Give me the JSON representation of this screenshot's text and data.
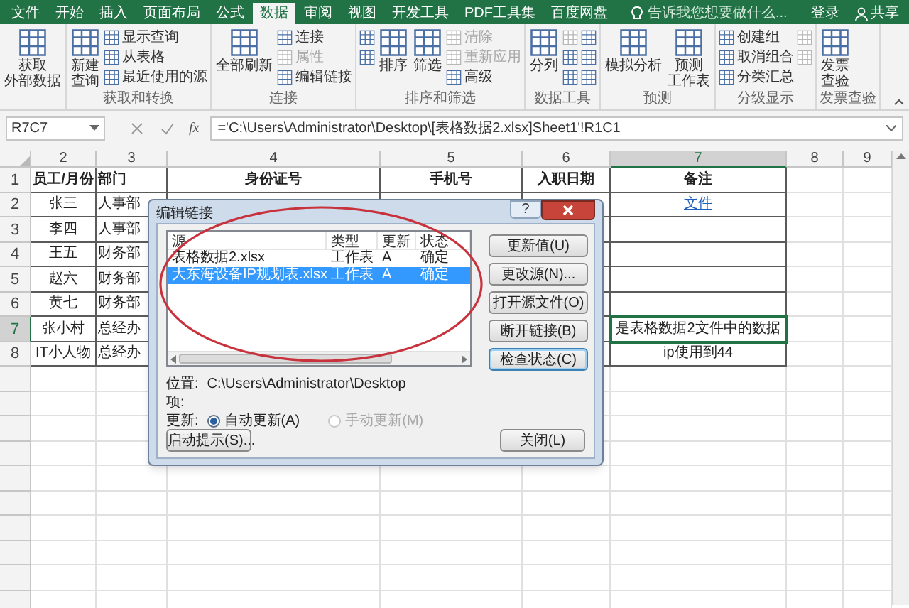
{
  "tabs": [
    {
      "label": "文件",
      "selected": false
    },
    {
      "label": "开始",
      "selected": false
    },
    {
      "label": "插入",
      "selected": false
    },
    {
      "label": "页面布局",
      "selected": false
    },
    {
      "label": "公式",
      "selected": false
    },
    {
      "label": "数据",
      "selected": true
    },
    {
      "label": "审阅",
      "selected": false
    },
    {
      "label": "视图",
      "selected": false
    },
    {
      "label": "开发工具",
      "selected": false
    },
    {
      "label": "PDF工具集",
      "selected": false
    },
    {
      "label": "百度网盘",
      "selected": false
    }
  ],
  "tell_me": {
    "placeholder": "告诉我您想要做什么..."
  },
  "account": {
    "sign_in": "登录",
    "share": "共享"
  },
  "ribbon": {
    "groups": [
      {
        "items": [
          {
            "kind": "large",
            "lines": [
              "获取",
              "外部数据"
            ],
            "disabled": false
          }
        ]
      },
      {
        "label": "获取和转换",
        "items": [
          {
            "kind": "large",
            "lines": [
              "新建",
              "查询"
            ],
            "disabled": false
          },
          {
            "kind": "small",
            "label": "显示查询",
            "disabled": false
          },
          {
            "kind": "small",
            "label": "从表格",
            "disabled": false
          },
          {
            "kind": "small",
            "label": "最近使用的源",
            "disabled": false
          }
        ]
      },
      {
        "label": "连接",
        "items": [
          {
            "kind": "large",
            "lines": [
              "全部刷新"
            ],
            "disabled": false
          },
          {
            "kind": "small",
            "label": "连接",
            "disabled": false
          },
          {
            "kind": "small",
            "label": "属性",
            "disabled": true
          },
          {
            "kind": "small",
            "label": "编辑链接",
            "disabled": false
          }
        ]
      },
      {
        "label": "排序和筛选",
        "items": [
          {
            "kind": "icon",
            "disabled": false
          },
          {
            "kind": "icon",
            "disabled": false
          },
          {
            "kind": "large",
            "lines": [
              "排序"
            ],
            "disabled": false
          },
          {
            "kind": "large",
            "lines": [
              "筛选"
            ],
            "disabled": false
          },
          {
            "kind": "small",
            "label": "清除",
            "disabled": true
          },
          {
            "kind": "small",
            "label": "重新应用",
            "disabled": true
          },
          {
            "kind": "small",
            "label": "高级",
            "disabled": false
          }
        ]
      },
      {
        "label": "数据工具",
        "items": [
          {
            "kind": "large",
            "lines": [
              "分列"
            ],
            "disabled": false
          },
          {
            "kind": "icon",
            "disabled": true
          },
          {
            "kind": "icon",
            "disabled": false
          },
          {
            "kind": "icon",
            "disabled": false
          },
          {
            "kind": "icon",
            "disabled": false
          },
          {
            "kind": "icon",
            "disabled": false
          },
          {
            "kind": "icon",
            "disabled": false
          }
        ]
      },
      {
        "label": "预测",
        "items": [
          {
            "kind": "large",
            "lines": [
              "模拟分析"
            ],
            "disabled": false
          },
          {
            "kind": "large",
            "lines": [
              "预测",
              "工作表"
            ],
            "disabled": false
          }
        ]
      },
      {
        "label": "分级显示",
        "items": [
          {
            "kind": "small",
            "label": "创建组",
            "disabled": false
          },
          {
            "kind": "small",
            "label": "取消组合",
            "disabled": false
          },
          {
            "kind": "small",
            "label": "分类汇总",
            "disabled": false
          },
          {
            "kind": "icon",
            "disabled": true
          },
          {
            "kind": "icon",
            "disabled": true
          }
        ]
      },
      {
        "label": "发票查验",
        "items": [
          {
            "kind": "large",
            "lines": [
              "发票",
              "查验"
            ],
            "disabled": false
          }
        ]
      }
    ]
  },
  "formula_bar": {
    "name_box": "R7C7",
    "function_label": "fx",
    "formula": "='C:\\Users\\Administrator\\Desktop\\[表格数据2.xlsx]Sheet1'!R1C1"
  },
  "sheet": {
    "columns": [
      {
        "label": "2",
        "selected": false
      },
      {
        "label": "3",
        "selected": false
      },
      {
        "label": "4",
        "selected": false
      },
      {
        "label": "5",
        "selected": false
      },
      {
        "label": "6",
        "selected": false
      },
      {
        "label": "7",
        "selected": true
      },
      {
        "label": "8",
        "selected": false
      },
      {
        "label": "9",
        "selected": false
      }
    ],
    "header_row": {
      "label": "1",
      "selected": false,
      "cells": [
        "员工/月份",
        "部门",
        "身份证号",
        "手机号",
        "入职日期",
        "备注"
      ]
    },
    "rows": [
      {
        "label": "2",
        "selected": false,
        "employee": "张三",
        "department": "人事部",
        "note": {
          "kind": "link",
          "text": "文件"
        }
      },
      {
        "label": "3",
        "selected": false,
        "employee": "李四",
        "department": "人事部"
      },
      {
        "label": "4",
        "selected": false,
        "employee": "王五",
        "department": "财务部"
      },
      {
        "label": "5",
        "selected": false,
        "employee": "赵六",
        "department": "财务部"
      },
      {
        "label": "6",
        "selected": false,
        "employee": "黄七",
        "department": "财务部"
      },
      {
        "label": "7",
        "selected": true,
        "employee": "张小村",
        "department": "总经办",
        "note": {
          "kind": "text",
          "text": "是表格数据2文件中的数据"
        }
      },
      {
        "label": "8",
        "selected": false,
        "employee": "IT小人物",
        "department": "总经办",
        "note": {
          "kind": "text",
          "text": "ip使用到44"
        }
      }
    ]
  },
  "dialog": {
    "title": "编辑链接",
    "help": "?",
    "columns": [
      "源",
      "类型",
      "更新",
      "状态"
    ],
    "links": [
      {
        "source": "表格数据2.xlsx",
        "type": "工作表",
        "update": "A",
        "status": "确定",
        "selected": false
      },
      {
        "source": "大东海设备IP规划表.xlsx",
        "type": "工作表",
        "update": "A",
        "status": "确定",
        "selected": true
      }
    ],
    "buttons": [
      {
        "label": "更新值(U)",
        "default": false
      },
      {
        "label": "更改源(N)...",
        "default": false
      },
      {
        "label": "打开源文件(O)",
        "default": false
      },
      {
        "label": "断开链接(B)",
        "default": false
      },
      {
        "label": "检查状态(C)",
        "default": true
      }
    ],
    "location_label": "位置:",
    "location": "C:\\Users\\Administrator\\Desktop",
    "item_label": "项:",
    "update_label": "更新:",
    "update_options": [
      {
        "label": "自动更新(A)",
        "selected": true,
        "disabled": false
      },
      {
        "label": "手动更新(M)",
        "selected": false,
        "disabled": true
      }
    ],
    "startup_button": "启动提示(S)...",
    "close_button": "关闭(L)"
  }
}
